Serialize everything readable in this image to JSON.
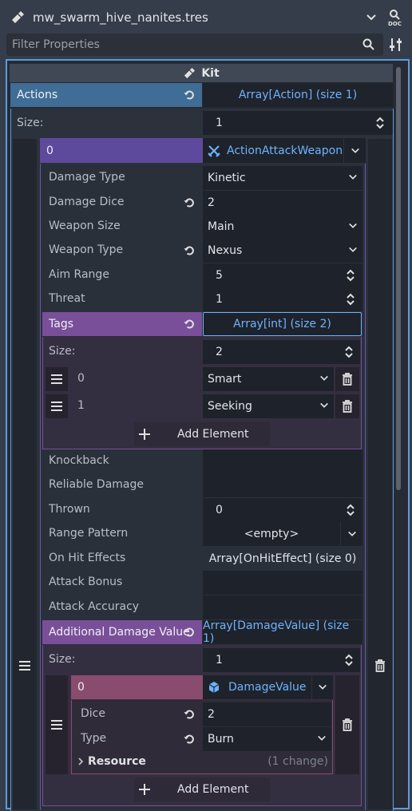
{
  "header": {
    "file_name": "mw_swarm_hive_nanites.tres",
    "filter_placeholder": "Filter Properties"
  },
  "kit": {
    "title": "Kit",
    "actions": {
      "label": "Actions",
      "value": "Array[Action] (size 1)",
      "size_label": "Size:",
      "size_value": "1",
      "element": {
        "index": "0",
        "type": "ActionAttackWeapon",
        "properties": [
          {
            "label": "Damage Type",
            "value": "Kinetic",
            "kind": "dropdown",
            "reset": false
          },
          {
            "label": "Damage Dice",
            "value": "2",
            "kind": "text",
            "reset": true
          },
          {
            "label": "Weapon Size",
            "value": "Main",
            "kind": "dropdown",
            "reset": false
          },
          {
            "label": "Weapon Type",
            "value": "Nexus",
            "kind": "dropdown",
            "reset": true
          },
          {
            "label": "Aim Range",
            "value": "5",
            "kind": "spin",
            "reset": false
          },
          {
            "label": "Threat",
            "value": "1",
            "kind": "spin",
            "reset": false
          }
        ],
        "tags": {
          "label": "Tags",
          "value": "Array[int] (size 2)",
          "size_label": "Size:",
          "size_value": "2",
          "items": [
            {
              "index": "0",
              "value": "Smart"
            },
            {
              "index": "1",
              "value": "Seeking"
            }
          ],
          "add_label": "Add Element"
        },
        "more_properties": [
          {
            "label": "Knockback",
            "value": ""
          },
          {
            "label": "Reliable Damage",
            "value": ""
          },
          {
            "label": "Thrown",
            "value": "0"
          },
          {
            "label": "Range Pattern",
            "value": "<empty>"
          },
          {
            "label": "On Hit Effects",
            "value": "Array[OnHitEffect] (size 0)"
          },
          {
            "label": "Attack Bonus",
            "value": ""
          },
          {
            "label": "Attack Accuracy",
            "value": ""
          }
        ],
        "additional_damage": {
          "label": "Additional Damage Value",
          "value": "Array[DamageValue] (size 1)",
          "size_label": "Size:",
          "size_value": "1",
          "element": {
            "index": "0",
            "type": "DamageValue",
            "dice_label": "Dice",
            "dice_value": "2",
            "type_label": "Type",
            "type_value": "Burn",
            "resource_label": "Resource",
            "resource_changes": "(1 change)"
          },
          "add_label": "Add Element"
        }
      }
    }
  },
  "colors": {
    "accent_blue": "#6fb3ff",
    "actions_header": "#3f6d95",
    "element_purple": "#5e4a9c",
    "tags_purple": "#7a4f99",
    "damage_pink": "#8a4c6e"
  }
}
